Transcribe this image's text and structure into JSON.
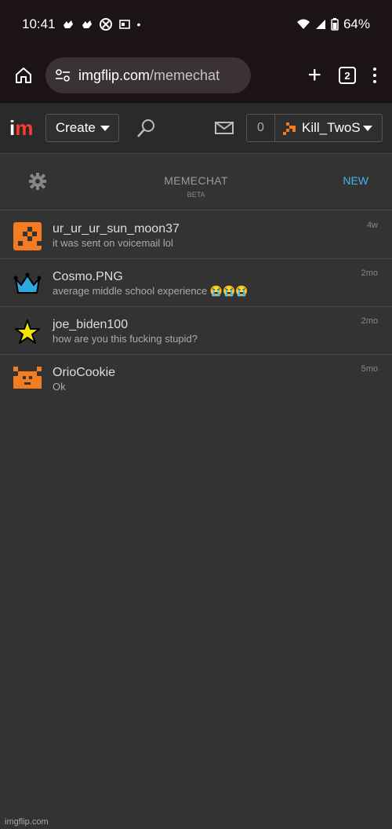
{
  "status_bar": {
    "time": "10:41",
    "dot": "•",
    "battery": "64%"
  },
  "browser": {
    "url_domain": "imgflip.com",
    "url_path": "/memechat",
    "tab_count": "2",
    "new_tab_symbol": "+"
  },
  "site_header": {
    "logo_i": "i",
    "logo_m": "m",
    "create_label": "Create",
    "notification_count": "0",
    "username": "Kill_TwoS"
  },
  "memechat": {
    "title": "MEMECHAT",
    "beta": "BETA",
    "new_label": "NEW"
  },
  "chats": [
    {
      "name": "ur_ur_ur_sun_moon37",
      "message": "it was sent on voicemail lol",
      "time": "4w",
      "avatar": "orange-checker-icon"
    },
    {
      "name": "Cosmo.PNG",
      "message": "average middle school experience 😭😭😭",
      "time": "2mo",
      "avatar": "crown-icon"
    },
    {
      "name": "joe_biden100",
      "message": "how are you this fucking stupid?",
      "time": "2mo",
      "avatar": "star-icon"
    },
    {
      "name": "OrioCookie",
      "message": "Ok",
      "time": "5mo",
      "avatar": "orange-pixel-face-icon"
    }
  ],
  "footer": {
    "watermark": "imgflip.com"
  },
  "colors": {
    "accent_blue": "#3db8f0",
    "logo_red": "#ff3a30",
    "orange": "#f47c20"
  }
}
